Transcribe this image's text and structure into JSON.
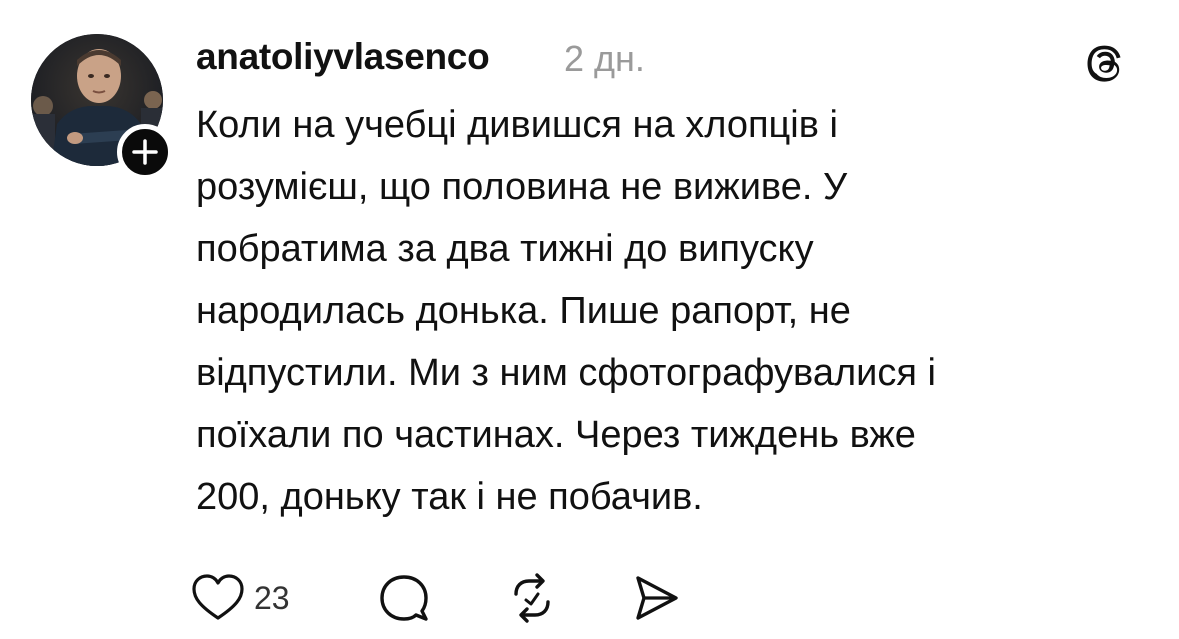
{
  "post": {
    "author": {
      "username": "anatoliyvlasenco",
      "avatar_icon": "user-avatar",
      "follow_icon": "plus-icon"
    },
    "timestamp": "2 дн.",
    "app_logo_icon": "threads-logo-icon",
    "text": "Коли на учебці дивишся на хлопців і\nрозумієш, що половина не виживе. У\nпобратима за два тижні до випуску\nнародилась донька. Пише рапорт, не\nвідпустили. Ми з ним сфотографувалися і\nпоїхали по частинах. Через тиждень вже\n200, доньку так і не побачив.",
    "actions": {
      "like": {
        "icon": "heart-icon",
        "count": "23"
      },
      "reply": {
        "icon": "comment-icon"
      },
      "repost": {
        "icon": "repost-icon"
      },
      "share": {
        "icon": "send-icon"
      }
    }
  },
  "colors": {
    "text": "#111111",
    "muted": "#9a9a9a",
    "badge": "#0a0a0a",
    "background": "#ffffff"
  }
}
